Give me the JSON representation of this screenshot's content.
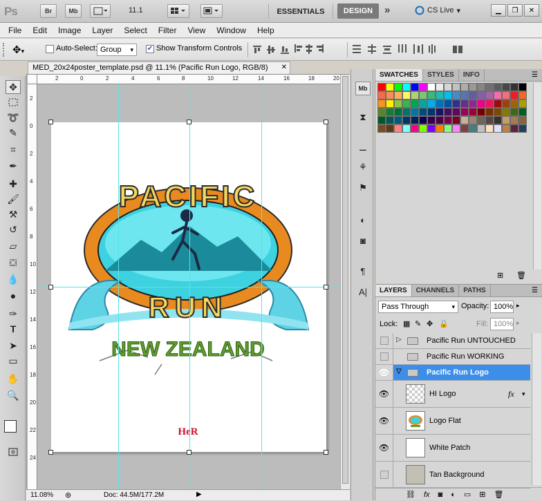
{
  "app": {
    "logo": "Ps",
    "btn_br": "Br",
    "btn_mb": "Mb",
    "zoom": "11.1",
    "ws_essentials": "ESSENTIALS",
    "ws_design": "DESIGN",
    "more": "»",
    "cs_live": "CS Live"
  },
  "menu": [
    "File",
    "Edit",
    "Image",
    "Layer",
    "Select",
    "Filter",
    "View",
    "Window",
    "Help"
  ],
  "options": {
    "auto_select_label": "Auto-Select:",
    "auto_select_checked": false,
    "group_value": "Group",
    "show_transform_label": "Show Transform Controls",
    "show_transform_checked": true
  },
  "doc": {
    "tab_title": "MED_20x24poster_template.psd @ 11.1% (Pacific Run Logo, RGB/8)",
    "close": "✕",
    "zoom": "11.08%",
    "doc_info": "Doc: 44.5M/177.2M"
  },
  "ruler_h": [
    "4",
    "2",
    "0",
    "2",
    "4",
    "6",
    "8",
    "10",
    "12",
    "14",
    "16",
    "18",
    "20"
  ],
  "ruler_v": [
    "2",
    "0",
    "2",
    "4",
    "6",
    "8",
    "10",
    "12",
    "14",
    "16",
    "18",
    "20",
    "22",
    "24"
  ],
  "logo": {
    "line1": "PACIFIC",
    "line2": "RUN",
    "line3": "NEW ZEALAND",
    "footer_mark": "HeR"
  },
  "swatches_panel": {
    "tabs": [
      "SWATCHES",
      "STYLES",
      "INFO"
    ]
  },
  "swatch_colors": [
    "#ff0000",
    "#ffff00",
    "#00ff00",
    "#00ffff",
    "#0000ff",
    "#ff00ff",
    "#ffffff",
    "#ebebeb",
    "#d6d6d6",
    "#c2c2c2",
    "#adadad",
    "#999999",
    "#858585",
    "#707070",
    "#5c5c5c",
    "#474747",
    "#333333",
    "#000000",
    "#f26c4f",
    "#f68e55",
    "#fbaf5c",
    "#fff467",
    "#acd372",
    "#7dc473",
    "#3cb878",
    "#1cbbb4",
    "#00bff3",
    "#438ccb",
    "#5574b9",
    "#605ca8",
    "#855fa8",
    "#a763a8",
    "#f06ea9",
    "#f26d7d",
    "#ee1c24",
    "#f26522",
    "#f7941d",
    "#fff200",
    "#8dc63f",
    "#39b54a",
    "#00a651",
    "#00a99d",
    "#00aeef",
    "#0072bc",
    "#0054a5",
    "#2e3192",
    "#662d91",
    "#92278f",
    "#ec008c",
    "#ed145b",
    "#9e0b0f",
    "#a0410d",
    "#a3620a",
    "#aba000",
    "#598527",
    "#197b30",
    "#007236",
    "#00746b",
    "#0076a3",
    "#004a80",
    "#003471",
    "#1b1464",
    "#440e62",
    "#630460",
    "#9e005d",
    "#9e0039",
    "#790000",
    "#7b2e00",
    "#7d4900",
    "#827b00",
    "#406618",
    "#005e20",
    "#005826",
    "#005952",
    "#005b7f",
    "#003663",
    "#002157",
    "#0d004c",
    "#32004b",
    "#4b0049",
    "#7b0046",
    "#7a0026",
    "#c7b299",
    "#998675",
    "#736357",
    "#534741",
    "#37302d",
    "#c69c6d",
    "#a67c52",
    "#8c6239",
    "#754c24",
    "#603913",
    "#ff8080",
    "#80ffff",
    "#ff0080",
    "#80ff00",
    "#8000ff",
    "#ff8000",
    "#80ff80",
    "#ff80ff",
    "#804040",
    "#408080",
    "#c0c0c0",
    "#ffe0c0",
    "#e0e0ff",
    "#c08040",
    "#602040",
    "#204060"
  ],
  "layers_panel": {
    "tabs": [
      "LAYERS",
      "CHANNELS",
      "PATHS"
    ],
    "blend_mode": "Pass Through",
    "opacity_label": "Opacity:",
    "opacity": "100%",
    "lock_label": "Lock:",
    "fill_label": "Fill:",
    "fill": "100%",
    "layers": [
      {
        "name": "Pacific Run UNTOUCHED",
        "type": "group",
        "visible": false
      },
      {
        "name": "Pacific Run WORKING",
        "type": "group",
        "visible": false
      },
      {
        "name": "Pacific Run Logo",
        "type": "group",
        "visible": true,
        "selected": true
      },
      {
        "name": "HI Logo",
        "type": "layer",
        "visible": true,
        "fx": "fx"
      },
      {
        "name": "Logo Flat",
        "type": "layer",
        "visible": true
      },
      {
        "name": "White Patch",
        "type": "layer",
        "visible": true
      },
      {
        "name": "Tan Background",
        "type": "layer",
        "visible": false
      }
    ]
  },
  "colors": {
    "accent_selected": "#3d8ee8",
    "guide": "#52e6e6"
  }
}
